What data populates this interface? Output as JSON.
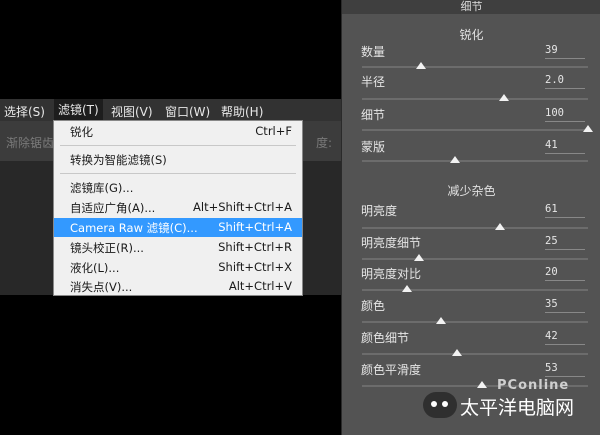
{
  "menubar": {
    "items": [
      {
        "label": "选择(S)",
        "active": false
      },
      {
        "label": "滤镜(T)",
        "active": true
      },
      {
        "label": "视图(V)",
        "active": false
      },
      {
        "label": "窗口(W)",
        "active": false
      },
      {
        "label": "帮助(H)",
        "active": false
      }
    ]
  },
  "options_bar": {
    "left_text": "渐除锯齿",
    "right_text": "度:"
  },
  "filter_menu": {
    "items": [
      {
        "label": "锐化",
        "shortcut": "Ctrl+F",
        "highlighted": false
      },
      {
        "label": "转换为智能滤镜(S)",
        "shortcut": "",
        "highlighted": false
      },
      {
        "label": "滤镜库(G)...",
        "shortcut": "",
        "highlighted": false
      },
      {
        "label": "自适应广角(A)...",
        "shortcut": "Alt+Shift+Ctrl+A",
        "highlighted": false
      },
      {
        "label": "Camera Raw 滤镜(C)...",
        "shortcut": "Shift+Ctrl+A",
        "highlighted": true
      },
      {
        "label": "镜头校正(R)...",
        "shortcut": "Shift+Ctrl+R",
        "highlighted": false
      },
      {
        "label": "液化(L)...",
        "shortcut": "Shift+Ctrl+X",
        "highlighted": false
      },
      {
        "label": "消失点(V)...",
        "shortcut": "Alt+Ctrl+V",
        "highlighted": false
      }
    ]
  },
  "detail_panel": {
    "header": "细节",
    "sharpening": {
      "title": "锐化",
      "sliders": [
        {
          "label": "数量",
          "value": "39",
          "level": 0.26
        },
        {
          "label": "半径",
          "value": "2.0",
          "level": 0.63
        },
        {
          "label": "细节",
          "value": "100",
          "level": 1.0
        },
        {
          "label": "蒙版",
          "value": "41",
          "level": 0.41
        }
      ]
    },
    "noise_reduction": {
      "title": "减少杂色",
      "sliders": [
        {
          "label": "明亮度",
          "value": "61",
          "level": 0.61
        },
        {
          "label": "明亮度细节",
          "value": "25",
          "level": 0.25
        },
        {
          "label": "明亮度对比",
          "value": "20",
          "level": 0.2
        },
        {
          "label": "颜色",
          "value": "35",
          "level": 0.35
        },
        {
          "label": "颜色细节",
          "value": "42",
          "level": 0.42
        },
        {
          "label": "颜色平滑度",
          "value": "53",
          "level": 0.53
        }
      ]
    }
  },
  "watermark": {
    "text": "太平洋电脑网",
    "logo_text": "PConline"
  }
}
